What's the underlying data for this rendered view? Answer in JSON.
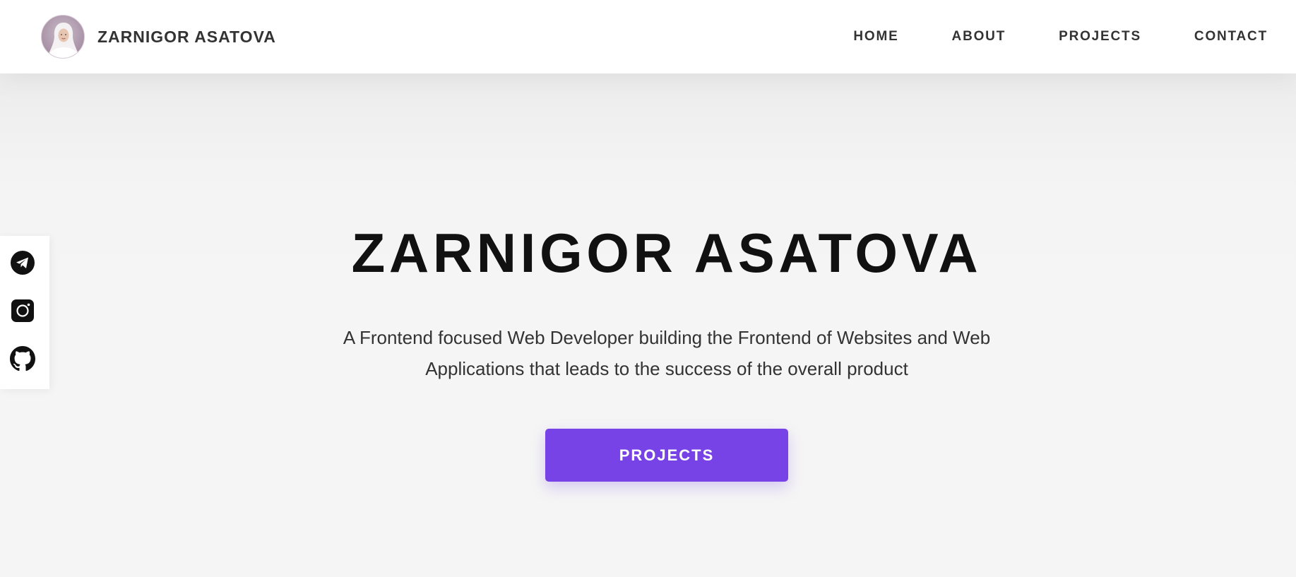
{
  "header": {
    "brand_name": "ZARNIGOR ASATOVA",
    "nav": [
      {
        "label": "HOME"
      },
      {
        "label": "ABOUT"
      },
      {
        "label": "PROJECTS"
      },
      {
        "label": "CONTACT"
      }
    ]
  },
  "socials": [
    {
      "icon": "telegram-icon"
    },
    {
      "icon": "instagram-icon"
    },
    {
      "icon": "github-icon"
    }
  ],
  "hero": {
    "title": "ZARNIGOR ASATOVA",
    "subtitle_line1": "A Frontend focused Web Developer building the Frontend of Websites and Web",
    "subtitle_line2": "Applications that leads to the success of the overall product",
    "button_label": "PROJECTS"
  },
  "colors": {
    "accent": "#7843e6",
    "text_dark": "#111111",
    "text": "#333333",
    "hero_bg": "#f5f5f5"
  }
}
